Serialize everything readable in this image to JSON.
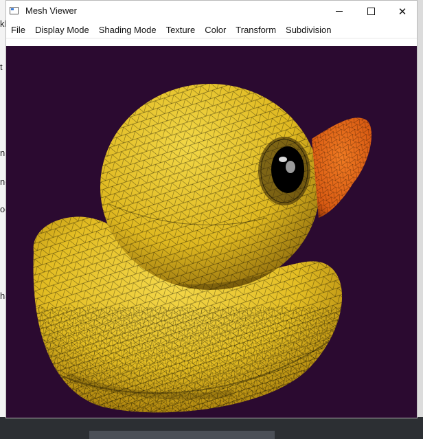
{
  "window": {
    "title": "Mesh Viewer",
    "close_glyph": "✕"
  },
  "menu": [
    "File",
    "Display Mode",
    "Shading Mode",
    "Texture",
    "Color",
    "Transform",
    "Subdivision"
  ],
  "background_fragments": [
    "kl",
    "t",
    "n",
    "ne",
    "oc",
    "ha"
  ],
  "viewport": {
    "background_color": "#2b0a30",
    "model": "rubber-duck-mesh",
    "body_color": "#e8c52a",
    "beak_color": "#e86a1a",
    "wireframe_color": "#000000"
  }
}
